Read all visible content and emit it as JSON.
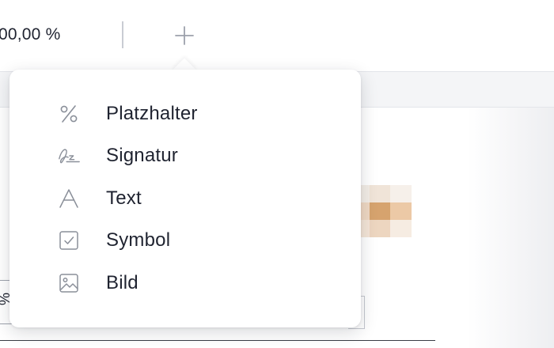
{
  "toolbar": {
    "zoom_value": "00,00 %",
    "add_icon": "plus-icon"
  },
  "menu": {
    "items": [
      {
        "label": "Platzhalter",
        "icon": "percent-icon"
      },
      {
        "label": "Signatur",
        "icon": "signature-icon"
      },
      {
        "label": "Text",
        "icon": "text-icon"
      },
      {
        "label": "Symbol",
        "icon": "checkbox-icon"
      },
      {
        "label": "Bild",
        "icon": "image-icon"
      }
    ]
  },
  "document": {
    "field_stub_label": "%"
  },
  "colors": {
    "text": "#1f2330",
    "icon": "#8a8f99",
    "accent_image": "#d6a36e",
    "canvas_band": "#f4f5f7"
  }
}
